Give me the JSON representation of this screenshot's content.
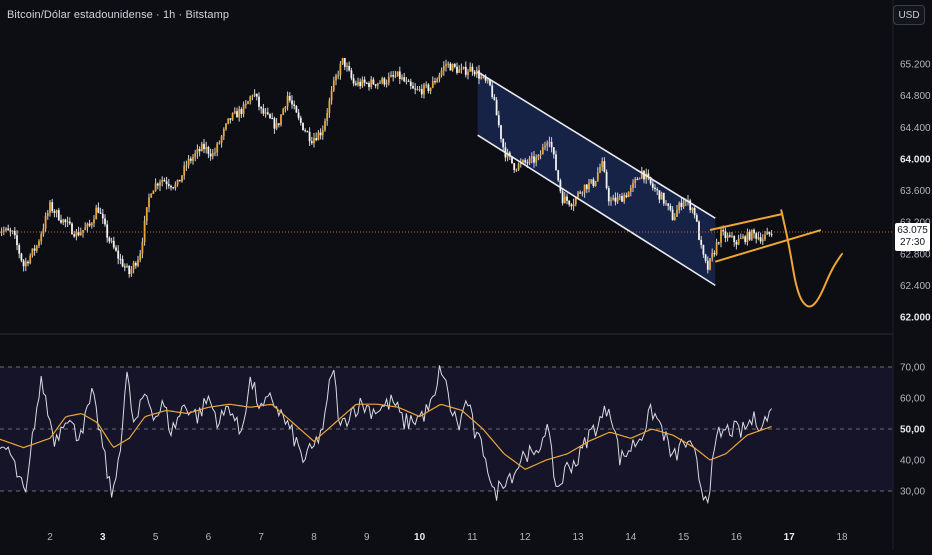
{
  "header": {
    "title": "Bitcoin/Dólar estadounidense · 1h · Bitstamp",
    "currency": "USD"
  },
  "price_tag": {
    "price": "63.075",
    "countdown": "27:30"
  },
  "colors": {
    "background": "#0c0e13",
    "candle_body": "#e9a73a",
    "wick": "#d1d4dc",
    "channel_fill": "#1a2a58",
    "pattern_orange": "#f0a534",
    "rsi_line": "#d8dbe3",
    "rsi_ma": "#e9a73a",
    "rsi_band": "#151428"
  },
  "chart_data": [
    {
      "type": "candlestick",
      "title": "Bitcoin/Dólar estadounidense · 1h · Bitstamp",
      "ylim": [
        61900,
        65500
      ],
      "y_ticks": [
        "65.200",
        "64.800",
        "64.400",
        "64.000",
        "63.600",
        "63.200",
        "62.800",
        "62.400",
        "62.000"
      ],
      "y_ticks_bold": [
        "64.000",
        "62.000"
      ],
      "x_ticks": [
        "2",
        "3",
        "5",
        "6",
        "7",
        "8",
        "9",
        "10",
        "11",
        "12",
        "13",
        "14",
        "15",
        "16",
        "17",
        "18"
      ],
      "x_ticks_bold": [
        "3",
        "10",
        "17"
      ],
      "last_price": 63075,
      "close_path": [
        [
          1.0,
          63120
        ],
        [
          1.3,
          63050
        ],
        [
          1.5,
          62650
        ],
        [
          1.75,
          62900
        ],
        [
          2.0,
          63400
        ],
        [
          2.2,
          63250
        ],
        [
          2.5,
          63050
        ],
        [
          2.75,
          63150
        ],
        [
          2.9,
          63400
        ],
        [
          3.1,
          63000
        ],
        [
          3.3,
          62750
        ],
        [
          3.5,
          62550
        ],
        [
          3.7,
          62800
        ],
        [
          3.9,
          63600
        ],
        [
          4.1,
          63750
        ],
        [
          4.4,
          63650
        ],
        [
          4.6,
          63950
        ],
        [
          4.9,
          64150
        ],
        [
          5.1,
          64050
        ],
        [
          5.4,
          64500
        ],
        [
          5.7,
          64650
        ],
        [
          5.85,
          64850
        ],
        [
          6.0,
          64600
        ],
        [
          6.3,
          64400
        ],
        [
          6.5,
          64800
        ],
        [
          6.7,
          64500
        ],
        [
          6.95,
          64250
        ],
        [
          7.15,
          64350
        ],
        [
          7.4,
          65000
        ],
        [
          7.55,
          65250
        ],
        [
          7.75,
          64950
        ],
        [
          8.0,
          64950
        ],
        [
          8.3,
          64980
        ],
        [
          8.6,
          65050
        ],
        [
          8.9,
          64850
        ],
        [
          9.2,
          64900
        ],
        [
          9.5,
          65200
        ],
        [
          9.8,
          65100
        ],
        [
          10.0,
          65150
        ],
        [
          10.2,
          65000
        ],
        [
          10.35,
          64900
        ],
        [
          10.6,
          64100
        ],
        [
          10.8,
          63900
        ],
        [
          11.0,
          63950
        ],
        [
          11.25,
          64000
        ],
        [
          11.45,
          64300
        ],
        [
          11.7,
          63500
        ],
        [
          11.9,
          63450
        ],
        [
          12.1,
          63650
        ],
        [
          12.3,
          63700
        ],
        [
          12.45,
          63950
        ],
        [
          12.6,
          63450
        ],
        [
          12.8,
          63500
        ],
        [
          13.0,
          63600
        ],
        [
          13.2,
          63850
        ],
        [
          13.4,
          63650
        ],
        [
          13.6,
          63500
        ],
        [
          13.8,
          63250
        ],
        [
          14.0,
          63500
        ],
        [
          14.2,
          63350
        ],
        [
          14.35,
          62800
        ],
        [
          14.45,
          62600
        ],
        [
          14.7,
          63050
        ],
        [
          15.0,
          62950
        ],
        [
          15.3,
          63050
        ],
        [
          15.5,
          63000
        ],
        [
          15.7,
          63075
        ]
      ],
      "annotations": {
        "descending_channel": {
          "upper": [
            [
              10.1,
              65100
            ],
            [
              14.6,
              63250
            ]
          ],
          "lower": [
            [
              10.1,
              64300
            ],
            [
              14.6,
              62400
            ]
          ]
        },
        "rising_wedge": {
          "upper": [
            [
              14.5,
              63100
            ],
            [
              15.85,
              63300
            ]
          ],
          "lower": [
            [
              14.6,
              62700
            ],
            [
              16.6,
              63100
            ]
          ]
        },
        "projected_path": [
          [
            15.85,
            63350
          ],
          [
            16.0,
            62900
          ],
          [
            16.15,
            62300
          ],
          [
            16.35,
            62100
          ],
          [
            16.55,
            62200
          ],
          [
            16.8,
            62600
          ],
          [
            17.0,
            62800
          ]
        ]
      }
    },
    {
      "type": "line",
      "series": [
        {
          "values_kind": "rsi"
        },
        {
          "values_kind": "rsi_ma"
        }
      ],
      "ylim": [
        25,
        75
      ],
      "y_ticks": [
        "70,00",
        "60,00",
        "50,00",
        "40,00",
        "30,00"
      ],
      "y_ticks_bold": [
        "50,00"
      ],
      "levels": [
        70,
        50,
        30
      ],
      "rsi": [
        [
          1.0,
          40
        ],
        [
          1.2,
          44
        ],
        [
          1.45,
          32
        ],
        [
          1.55,
          28
        ],
        [
          1.7,
          52
        ],
        [
          1.85,
          66
        ],
        [
          1.95,
          56
        ],
        [
          2.1,
          46
        ],
        [
          2.3,
          55
        ],
        [
          2.5,
          48
        ],
        [
          2.65,
          52
        ],
        [
          2.8,
          61
        ],
        [
          2.95,
          49
        ],
        [
          3.1,
          34
        ],
        [
          3.2,
          28
        ],
        [
          3.35,
          48
        ],
        [
          3.45,
          68
        ],
        [
          3.6,
          50
        ],
        [
          3.8,
          62
        ],
        [
          4.0,
          54
        ],
        [
          4.15,
          58
        ],
        [
          4.3,
          49
        ],
        [
          4.55,
          58
        ],
        [
          4.8,
          54
        ],
        [
          5.0,
          60
        ],
        [
          5.2,
          52
        ],
        [
          5.4,
          58
        ],
        [
          5.6,
          48
        ],
        [
          5.8,
          66
        ],
        [
          6.0,
          56
        ],
        [
          6.2,
          60
        ],
        [
          6.4,
          54
        ],
        [
          6.6,
          48
        ],
        [
          6.8,
          40
        ],
        [
          7.0,
          44
        ],
        [
          7.2,
          52
        ],
        [
          7.35,
          71
        ],
        [
          7.5,
          50
        ],
        [
          7.7,
          56
        ],
        [
          7.9,
          58
        ],
        [
          8.1,
          56
        ],
        [
          8.3,
          57
        ],
        [
          8.5,
          59
        ],
        [
          8.7,
          52
        ],
        [
          8.9,
          53
        ],
        [
          9.1,
          55
        ],
        [
          9.3,
          60
        ],
        [
          9.4,
          71
        ],
        [
          9.6,
          56
        ],
        [
          9.75,
          51
        ],
        [
          9.9,
          60
        ],
        [
          10.05,
          48
        ],
        [
          10.25,
          42
        ],
        [
          10.4,
          28
        ],
        [
          10.6,
          34
        ],
        [
          10.8,
          36
        ],
        [
          11.0,
          43
        ],
        [
          11.2,
          40
        ],
        [
          11.4,
          52
        ],
        [
          11.6,
          30
        ],
        [
          11.8,
          38
        ],
        [
          12.0,
          40
        ],
        [
          12.2,
          48
        ],
        [
          12.4,
          52
        ],
        [
          12.6,
          58
        ],
        [
          12.8,
          40
        ],
        [
          13.0,
          44
        ],
        [
          13.2,
          48
        ],
        [
          13.4,
          56
        ],
        [
          13.6,
          50
        ],
        [
          13.8,
          40
        ],
        [
          14.0,
          46
        ],
        [
          14.2,
          42
        ],
        [
          14.35,
          30
        ],
        [
          14.45,
          28
        ],
        [
          14.65,
          48
        ],
        [
          14.9,
          50
        ],
        [
          15.1,
          49
        ],
        [
          15.3,
          53
        ],
        [
          15.5,
          52
        ],
        [
          15.7,
          56
        ]
      ],
      "rsi_ma": [
        [
          1.0,
          47
        ],
        [
          1.5,
          44
        ],
        [
          2.0,
          47
        ],
        [
          2.3,
          54
        ],
        [
          2.6,
          55
        ],
        [
          2.9,
          52
        ],
        [
          3.2,
          44
        ],
        [
          3.5,
          47
        ],
        [
          3.8,
          54
        ],
        [
          4.2,
          56
        ],
        [
          4.6,
          55
        ],
        [
          5.0,
          57
        ],
        [
          5.4,
          58
        ],
        [
          5.8,
          57
        ],
        [
          6.2,
          58
        ],
        [
          6.6,
          52
        ],
        [
          7.0,
          46
        ],
        [
          7.4,
          52
        ],
        [
          7.8,
          58
        ],
        [
          8.2,
          58
        ],
        [
          8.6,
          57
        ],
        [
          9.0,
          54
        ],
        [
          9.4,
          58
        ],
        [
          9.8,
          56
        ],
        [
          10.2,
          50
        ],
        [
          10.6,
          42
        ],
        [
          11.0,
          37
        ],
        [
          11.4,
          40
        ],
        [
          11.8,
          42
        ],
        [
          12.2,
          46
        ],
        [
          12.6,
          49
        ],
        [
          13.0,
          47
        ],
        [
          13.4,
          50
        ],
        [
          13.8,
          48
        ],
        [
          14.2,
          44
        ],
        [
          14.5,
          40
        ],
        [
          14.8,
          42
        ],
        [
          15.2,
          48
        ],
        [
          15.7,
          51
        ]
      ]
    }
  ]
}
